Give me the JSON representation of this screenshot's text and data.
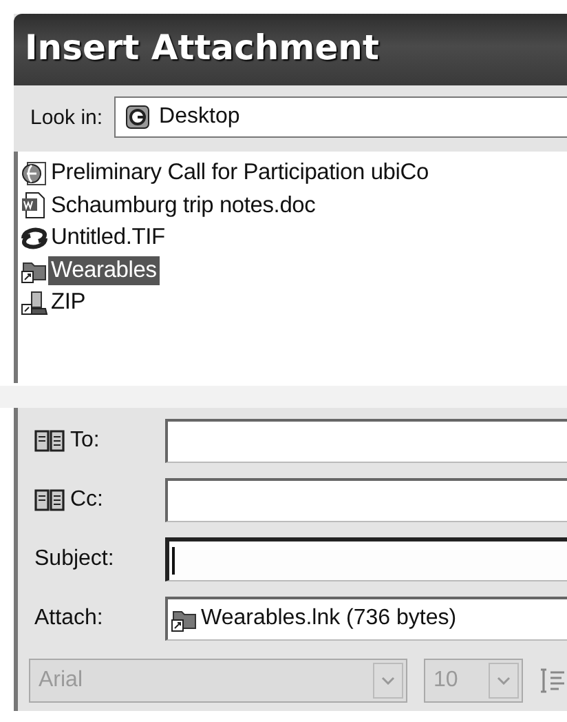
{
  "window": {
    "title": "Insert Attachment"
  },
  "look_in": {
    "label": "Look in:",
    "value": "Desktop"
  },
  "files": [
    {
      "name": "Preliminary Call for Participation ubiCo",
      "kind": "web",
      "selected": false
    },
    {
      "name": "Schaumburg trip notes.doc",
      "kind": "document",
      "selected": false
    },
    {
      "name": "Untitled.TIF",
      "kind": "image",
      "selected": false
    },
    {
      "name": "Wearables",
      "kind": "shortcut-folder",
      "selected": true
    },
    {
      "name": "ZIP",
      "kind": "drive",
      "selected": false
    }
  ],
  "fields": [
    {
      "label": "To:",
      "kind": "address",
      "focused": false
    },
    {
      "label": "Cc:",
      "kind": "address",
      "focused": false
    },
    {
      "label": "Subject:",
      "kind": "text",
      "focused": true
    },
    {
      "label": "Attach:",
      "kind": "attachment",
      "value": "Wearables.lnk (736 bytes)",
      "focused": false
    }
  ],
  "toolbar": {
    "disabled": true,
    "font": "Arial",
    "size": "10"
  }
}
